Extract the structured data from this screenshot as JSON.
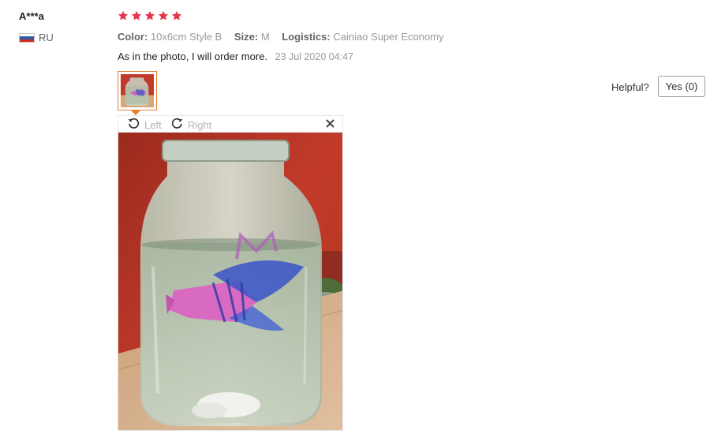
{
  "reviewer": {
    "name": "A***a",
    "country": "RU",
    "flag_colors": [
      "#ffffff",
      "#2a5caa",
      "#d52b1e"
    ]
  },
  "rating": {
    "stars": 5,
    "max": 5,
    "star_color": "#e6374a"
  },
  "attributes": [
    {
      "label": "Color:",
      "value": "10x6cm Style B"
    },
    {
      "label": "Size:",
      "value": "M"
    },
    {
      "label": "Logistics:",
      "value": "Cainiao Super Economy"
    }
  ],
  "comment": {
    "text": "As in the photo, I will order more.",
    "date": "23 Jul 2020 04:47"
  },
  "viewer": {
    "rotate_left_label": "Left",
    "rotate_right_label": "Right",
    "close_icon": "close-icon",
    "accent_color": "#e6812f"
  },
  "helpful": {
    "label": "Helpful?",
    "yes_button": "Yes (0)"
  }
}
